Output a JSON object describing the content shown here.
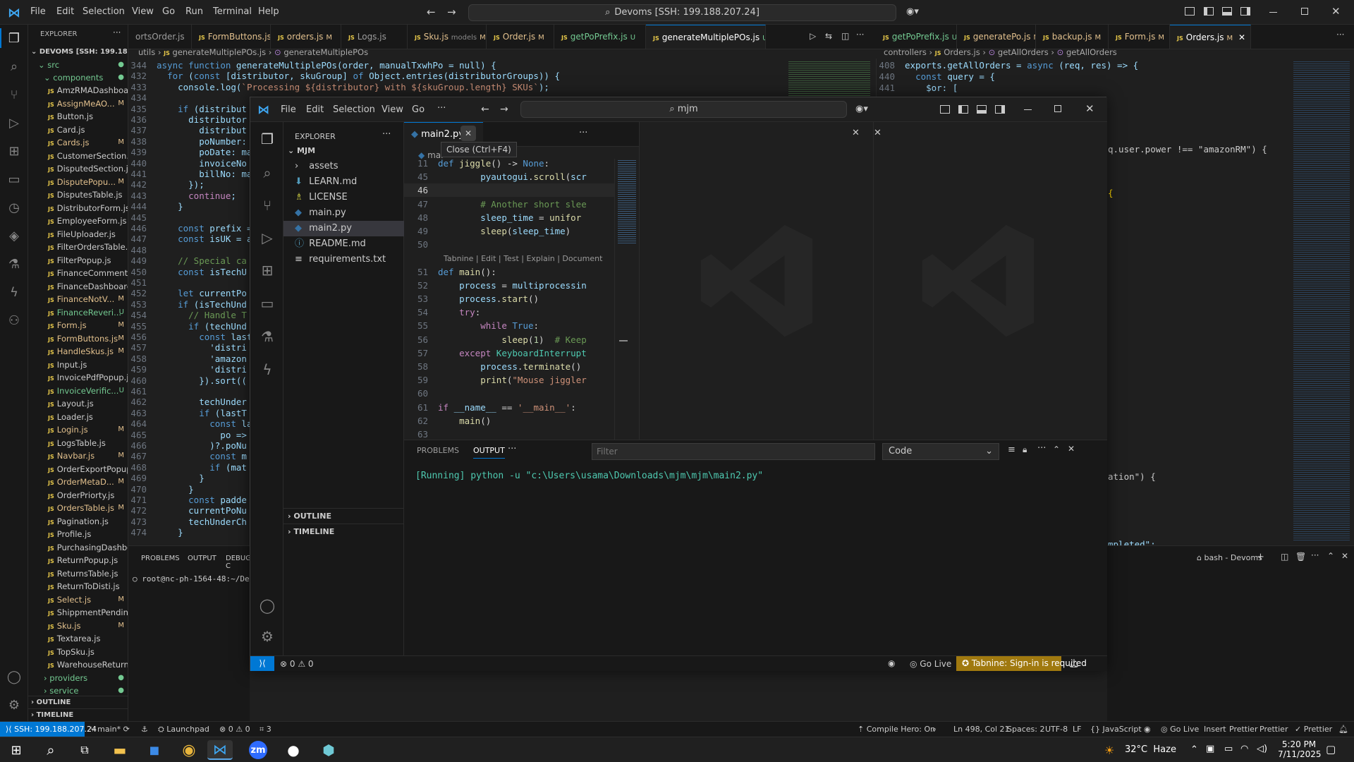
{
  "back": {
    "menu": [
      "File",
      "Edit",
      "Selection",
      "View",
      "Go",
      "Run",
      "Terminal",
      "Help"
    ],
    "search": "Devoms [SSH: 199.188.207.24]",
    "explorer_title": "EXPLORER",
    "root": "DEVOMS [SSH: 199.188.20...",
    "folder_src": "src",
    "folder_components": "components",
    "files": [
      {
        "name": "AmzRMADashboar...",
        "st": ""
      },
      {
        "name": "AssignMeAO...",
        "st": "M"
      },
      {
        "name": "Button.js",
        "st": ""
      },
      {
        "name": "Card.js",
        "st": ""
      },
      {
        "name": "Cards.js",
        "st": "M"
      },
      {
        "name": "CustomerSection.js",
        "st": ""
      },
      {
        "name": "DisputedSection.js",
        "st": ""
      },
      {
        "name": "DisputePopu...",
        "st": "M"
      },
      {
        "name": "DisputesTable.js",
        "st": ""
      },
      {
        "name": "DistributorForm.js",
        "st": ""
      },
      {
        "name": "EmployeeForm.js",
        "st": ""
      },
      {
        "name": "FileUploader.js",
        "st": ""
      },
      {
        "name": "FilterOrdersTable.js",
        "st": ""
      },
      {
        "name": "FilterPopup.js",
        "st": ""
      },
      {
        "name": "FinanceComments.js",
        "st": ""
      },
      {
        "name": "FinanceDashboard.js",
        "st": ""
      },
      {
        "name": "FinanceNotV...",
        "st": "M"
      },
      {
        "name": "FinanceReveri...",
        "st": "U"
      },
      {
        "name": "Form.js",
        "st": "M"
      },
      {
        "name": "FormButtons.js",
        "st": "M"
      },
      {
        "name": "HandleSkus.js",
        "st": "M"
      },
      {
        "name": "Input.js",
        "st": ""
      },
      {
        "name": "InvoicePdfPopup.js",
        "st": ""
      },
      {
        "name": "InvoiceVerific...",
        "st": "U"
      },
      {
        "name": "Layout.js",
        "st": ""
      },
      {
        "name": "Loader.js",
        "st": ""
      },
      {
        "name": "Login.js",
        "st": "M"
      },
      {
        "name": "LogsTable.js",
        "st": ""
      },
      {
        "name": "Navbar.js",
        "st": "M"
      },
      {
        "name": "OrderExportPopup.js",
        "st": ""
      },
      {
        "name": "OrderMetaD...",
        "st": "M"
      },
      {
        "name": "OrderPriorty.js",
        "st": ""
      },
      {
        "name": "OrdersTable.js",
        "st": "M"
      },
      {
        "name": "Pagination.js",
        "st": ""
      },
      {
        "name": "Profile.js",
        "st": ""
      },
      {
        "name": "PurchasingDashbo...",
        "st": ""
      },
      {
        "name": "ReturnPopup.js",
        "st": ""
      },
      {
        "name": "ReturnsTable.js",
        "st": ""
      },
      {
        "name": "ReturnToDisti.js",
        "st": ""
      },
      {
        "name": "Select.js",
        "st": "M"
      },
      {
        "name": "ShippmentPending...",
        "st": ""
      },
      {
        "name": "Sku.js",
        "st": "M"
      },
      {
        "name": "Textarea.js",
        "st": ""
      },
      {
        "name": "TopSku.js",
        "st": ""
      },
      {
        "name": "WarehouseReturn.js",
        "st": ""
      }
    ],
    "folder_providers": "providers",
    "folder_service": "service",
    "outline": "OUTLINE",
    "timeline": "TIMELINE",
    "tabs_left": [
      {
        "label": "ortsOrder.js",
        "m": ""
      },
      {
        "label": "FormButtons.js",
        "m": "M"
      },
      {
        "label": "orders.js",
        "m": "M"
      },
      {
        "label": "Logs.js",
        "m": ""
      },
      {
        "label": "Sku.js",
        "sub": "models",
        "m": "M"
      },
      {
        "label": "Order.js",
        "m": "M"
      },
      {
        "label": "getPoPrefix.js",
        "m": "U"
      },
      {
        "label": "generateMultiplePOs.js",
        "m": "U",
        "active": true
      }
    ],
    "tabs_right": [
      {
        "label": "getPoPrefix.js",
        "m": "U"
      },
      {
        "label": "generatePo.js",
        "m": "M"
      },
      {
        "label": "backup.js",
        "m": "M"
      },
      {
        "label": "Form.js",
        "m": "M"
      },
      {
        "label": "Orders.js",
        "m": "M",
        "active": true
      }
    ],
    "breadcrumb_left": [
      "utils",
      "generateMultiplePOs.js",
      "generateMultiplePOs"
    ],
    "breadcrumb_right": [
      "controllers",
      "Orders.js",
      "getAllOrders",
      "getAllOrders"
    ],
    "left_code": [
      {
        "n": "344",
        "t": "async function generateMultiplePOs(order, manualTxwhPo = null) {"
      },
      {
        "n": "432",
        "t": "  for (const [distributor, skuGroup] of Object.entries(distributorGroups)) {"
      },
      {
        "n": "433",
        "t": "    console.log(`Processing ${distributor} with ${skuGroup.length} SKUs`);"
      },
      {
        "n": "434",
        "t": ""
      },
      {
        "n": "435",
        "t": "    if (distribut"
      },
      {
        "n": "436",
        "t": "      distributor"
      },
      {
        "n": "437",
        "t": "        distribut"
      },
      {
        "n": "438",
        "t": "        poNumber:"
      },
      {
        "n": "439",
        "t": "        poDate: ma"
      },
      {
        "n": "440",
        "t": "        invoiceNo"
      },
      {
        "n": "441",
        "t": "        billNo: ma"
      },
      {
        "n": "442",
        "t": "      });"
      },
      {
        "n": "443",
        "t": "      continue;"
      },
      {
        "n": "444",
        "t": "    }"
      },
      {
        "n": "445",
        "t": ""
      },
      {
        "n": "446",
        "t": "    const prefix ="
      },
      {
        "n": "447",
        "t": "    const isUK = a"
      },
      {
        "n": "448",
        "t": ""
      },
      {
        "n": "449",
        "t": "    // Special ca"
      },
      {
        "n": "450",
        "t": "    const isTechU"
      },
      {
        "n": "451",
        "t": ""
      },
      {
        "n": "452",
        "t": "    let currentPo"
      },
      {
        "n": "453",
        "t": "    if (isTechUnd"
      },
      {
        "n": "454",
        "t": "      // Handle T"
      },
      {
        "n": "455",
        "t": "      if (techUnd"
      },
      {
        "n": "456",
        "t": "        const last"
      },
      {
        "n": "457",
        "t": "          'distri"
      },
      {
        "n": "458",
        "t": "          'amazon"
      },
      {
        "n": "459",
        "t": "          'distri"
      },
      {
        "n": "460",
        "t": "        }).sort(("
      },
      {
        "n": "461",
        "t": ""
      },
      {
        "n": "462",
        "t": "        techUnder"
      },
      {
        "n": "463",
        "t": "        if (lastT"
      },
      {
        "n": "464",
        "t": "          const la"
      },
      {
        "n": "465",
        "t": "            po =>"
      },
      {
        "n": "466",
        "t": "          )?.poNu"
      },
      {
        "n": "467",
        "t": "          const m"
      },
      {
        "n": "468",
        "t": "          if (mat"
      },
      {
        "n": "469",
        "t": "        }"
      },
      {
        "n": "470",
        "t": "      }"
      },
      {
        "n": "471",
        "t": "      const padde"
      },
      {
        "n": "472",
        "t": "      currentPoNu"
      },
      {
        "n": "473",
        "t": "      techUnderCh"
      },
      {
        "n": "474",
        "t": "    }"
      }
    ],
    "right_code": [
      {
        "n": "408",
        "t": "exports.getAllOrders = async (req, res) => {"
      },
      {
        "n": "440",
        "t": "  const query = {"
      },
      {
        "n": "441",
        "t": "    $or: ["
      }
    ],
    "right_fragments": [
      "q.user.power !== \"amazonRM\") {",
      "{",
      "ation\") {",
      "mpleted\":"
    ],
    "left_panel_tabs": [
      "PROBLEMS",
      "OUTPUT",
      "DEBUG C"
    ],
    "left_terminal": "root@nc-ph-1564-48:~/Devon",
    "right_terminal": "bash - Devoms",
    "status": {
      "remote": "SSH: 199.188.207.24",
      "branch": "main*",
      "launchpad": "Launchpad",
      "errors": "0",
      "warnings": "0",
      "ports": "3",
      "compile": "Compile Hero: On",
      "position": "Ln 498, Col 21",
      "spaces": "Spaces: 2",
      "encoding": "UTF-8",
      "eol": "LF",
      "language": "JavaScript",
      "golive": "Go Live",
      "insert": "Insert",
      "prettier1": "Prettier",
      "prettier2": "Prettier",
      "prettier3": "Prettier"
    }
  },
  "front": {
    "menu": [
      "File",
      "Edit",
      "Selection",
      "View",
      "Go"
    ],
    "search": "mjm",
    "explorer_title": "EXPLORER",
    "root": "MJM",
    "items": [
      {
        "name": "assets",
        "icon": "folder-icon",
        "color": "#cccccc"
      },
      {
        "name": "LEARN.md",
        "icon": "markdown-icon",
        "color": "#519aba"
      },
      {
        "name": "LICENSE",
        "icon": "license-icon",
        "color": "#cbcb41"
      },
      {
        "name": "main.py",
        "icon": "python-icon",
        "color": "#3572a5"
      },
      {
        "name": "main2.py",
        "icon": "python-icon",
        "color": "#3572a5",
        "selected": true
      },
      {
        "name": "README.md",
        "icon": "info-icon",
        "color": "#519aba"
      },
      {
        "name": "requirements.txt",
        "icon": "text-icon",
        "color": "#cccccc"
      }
    ],
    "outline": "OUTLINE",
    "timeline": "TIMELINE",
    "tab": "main2.py",
    "tooltip": "Close (Ctrl+F4)",
    "breadcrumb": "mai",
    "tabnine_lens": "Tabnine | Edit | Test | Explain | Document",
    "panel_tabs": [
      "PROBLEMS",
      "OUTPUT"
    ],
    "filter_placeholder": "Filter",
    "output_channel": "Code",
    "output_text": "[Running] python -u \"c:\\Users\\usama\\Downloads\\mjm\\mjm\\main2.py\"",
    "status_errors": "0",
    "status_warnings": "0",
    "golive": "Go Live",
    "tabnine": "Tabnine: Sign-in is required"
  },
  "taskbar": {
    "weather": "32°C  Haze",
    "time": "5:20 PM",
    "date": "7/11/2025"
  },
  "colors": {
    "accent": "#0078d4",
    "tabnine_bg": "#a0790f",
    "modified": "#e2c08d",
    "untracked": "#73c991"
  }
}
